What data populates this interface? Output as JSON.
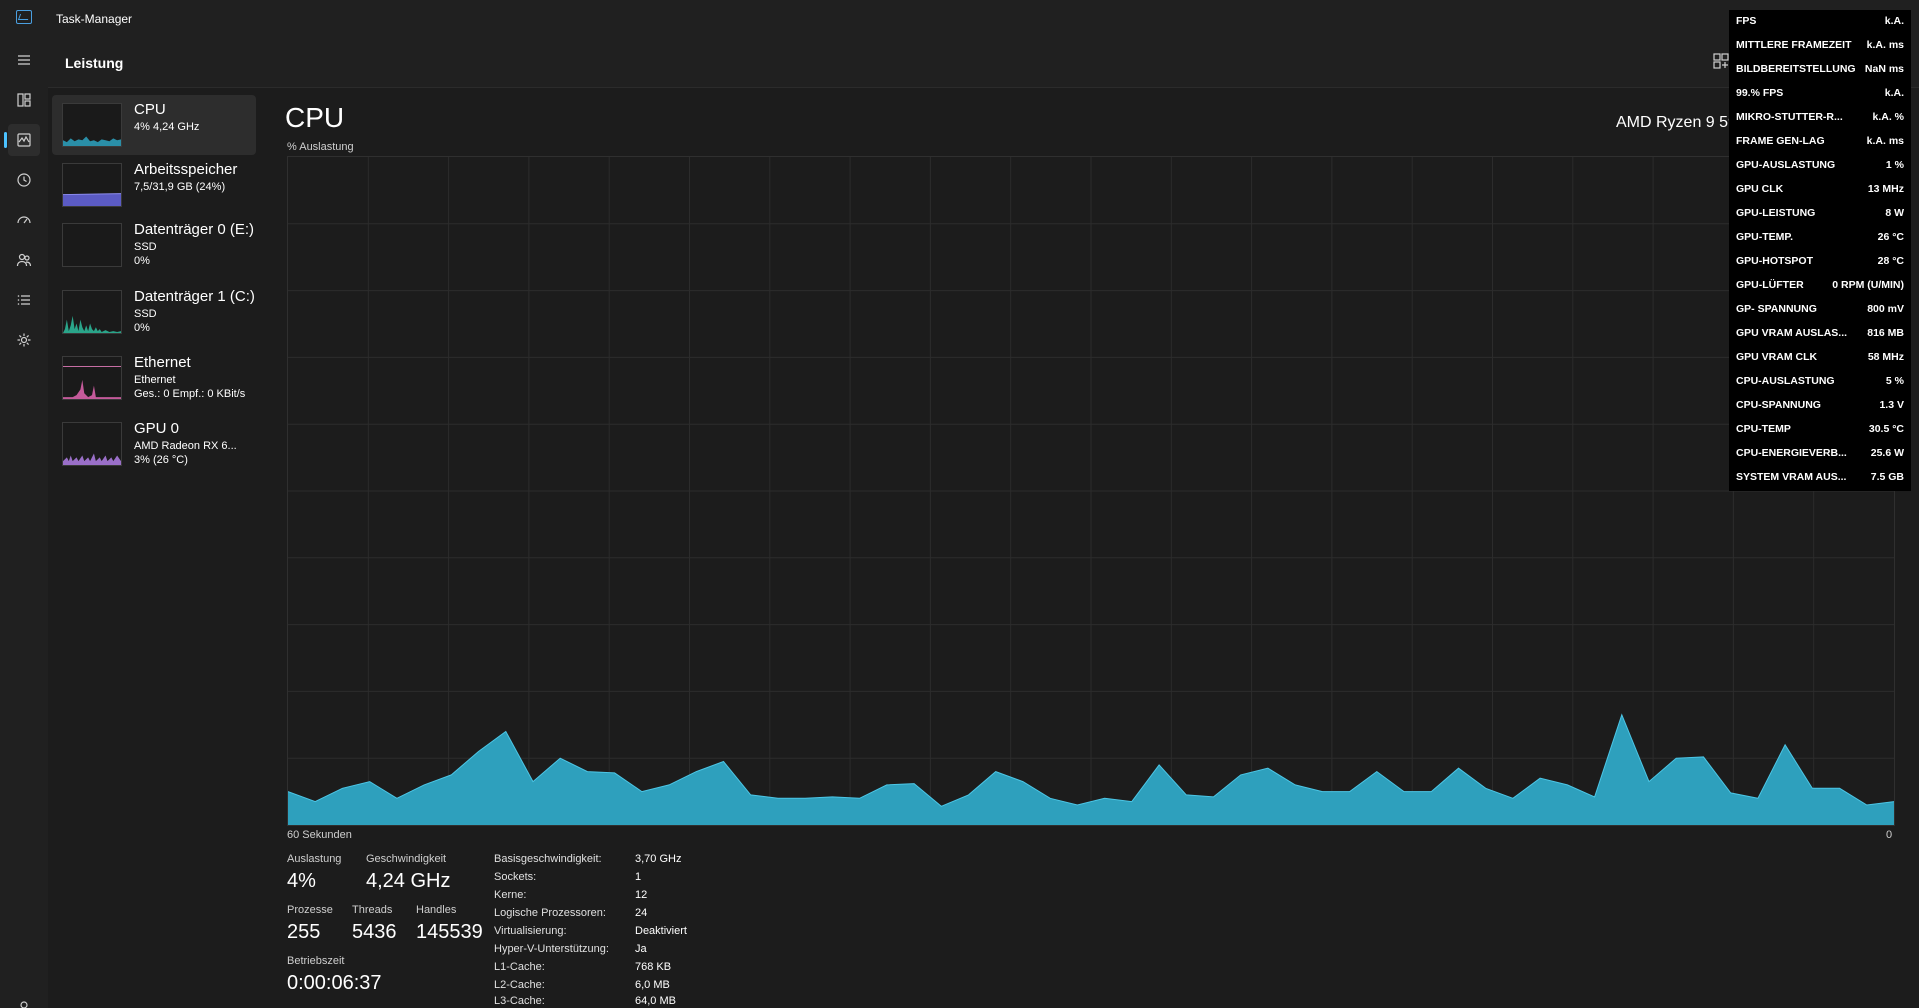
{
  "window": {
    "title": "Task-Manager"
  },
  "header": {
    "title": "Leistung"
  },
  "nav": {
    "items": [
      {
        "icon": "hamburger-icon"
      },
      {
        "icon": "processes-icon"
      },
      {
        "icon": "performance-icon"
      },
      {
        "icon": "history-icon"
      },
      {
        "icon": "startup-icon"
      },
      {
        "icon": "users-icon"
      },
      {
        "icon": "details-icon"
      },
      {
        "icon": "services-icon"
      },
      {
        "icon": "settings-icon"
      }
    ]
  },
  "sidebar": {
    "items": [
      {
        "name": "CPU",
        "sub1": "4% 4,24 GHz",
        "sub2": "",
        "sub3": "",
        "color": "#3ab8d8"
      },
      {
        "name": "Arbeitsspeicher",
        "sub1": "7,5/31,9 GB (24%)",
        "sub2": "",
        "sub3": "",
        "color": "#7a7ae0"
      },
      {
        "name": "Datenträger 0 (E:)",
        "sub1": "SSD",
        "sub2": "0%",
        "sub3": "",
        "color": "#3fb89c"
      },
      {
        "name": "Datenträger 1 (C:)",
        "sub1": "SSD",
        "sub2": "0%",
        "sub3": "",
        "color": "#3fb89c"
      },
      {
        "name": "Ethernet",
        "sub1": "Ethernet",
        "sub2": "Ges.: 0 Empf.: 0 KBit/s",
        "sub3": "",
        "color": "#e07ab8"
      },
      {
        "name": "GPU 0",
        "sub1": "AMD Radeon RX 6...",
        "sub2": "3% (26 °C)",
        "sub3": "",
        "color": "#b890e0"
      }
    ]
  },
  "main": {
    "title": "CPU",
    "subtitle": "% Auslastung",
    "model": "AMD Ryzen 9 59",
    "axis_left": "60 Sekunden",
    "axis_right": "0"
  },
  "chart_data": {
    "type": "area",
    "title": "CPU",
    "ylabel": "% Auslastung",
    "xlabel": "60 Sekunden",
    "ylim": [
      0,
      100
    ],
    "grid": true,
    "color": "#2ea0bd",
    "values": [
      5,
      3.5,
      5.5,
      6.5,
      4,
      6,
      7.5,
      11,
      14,
      6.5,
      10,
      8,
      7.8,
      5,
      6,
      8,
      9.5,
      4.5,
      4,
      4,
      4.2,
      4,
      6,
      6.2,
      2.8,
      4.5,
      8,
      6.5,
      4,
      3,
      4,
      3.5,
      9,
      4.5,
      4.2,
      7.5,
      8.5,
      6,
      5,
      5,
      8,
      5,
      5,
      8.5,
      5.5,
      4,
      7,
      6,
      4.2,
      16.5,
      6.5,
      10,
      10.2,
      4.8,
      4,
      12,
      5.5,
      5.5,
      3,
      3.5
    ]
  },
  "stats": {
    "auslastung_label": "Auslastung",
    "auslastung": "4%",
    "geschwindigkeit_label": "Geschwindigkeit",
    "geschwindigkeit": "4,24 GHz",
    "prozesse_label": "Prozesse",
    "prozesse": "255",
    "threads_label": "Threads",
    "threads": "5436",
    "handles_label": "Handles",
    "handles": "145539",
    "betriebszeit_label": "Betriebszeit",
    "betriebszeit": "0:00:06:37"
  },
  "info": [
    {
      "label": "Basisgeschwindigkeit:",
      "value": "3,70 GHz"
    },
    {
      "label": "Sockets:",
      "value": "1"
    },
    {
      "label": "Kerne:",
      "value": "12"
    },
    {
      "label": "Logische Prozessoren:",
      "value": "24"
    },
    {
      "label": "Virtualisierung:",
      "value": "Deaktiviert"
    },
    {
      "label": "Hyper-V-Unterstützung:",
      "value": "Ja"
    },
    {
      "label": "L1-Cache:",
      "value": "768 KB"
    },
    {
      "label": "L2-Cache:",
      "value": "6,0 MB"
    },
    {
      "label": "L3-Cache:",
      "value": "64,0 MB"
    }
  ],
  "overlay": [
    {
      "label": "FPS",
      "value": "k.A."
    },
    {
      "label": "MITTLERE FRAMEZEIT",
      "value": "k.A. ms"
    },
    {
      "label": "BILDBEREITSTELLUNG",
      "value": "NaN ms"
    },
    {
      "label": "99.% FPS",
      "value": "k.A."
    },
    {
      "label": "MIKRO-STUTTER-R...",
      "value": "k.A. %"
    },
    {
      "label": "FRAME GEN-LAG",
      "value": "k.A. ms"
    },
    {
      "label": "GPU-AUSLASTUNG",
      "value": "1 %"
    },
    {
      "label": "GPU CLK",
      "value": "13 MHz"
    },
    {
      "label": "GPU-LEISTUNG",
      "value": "8 W"
    },
    {
      "label": "GPU-TEMP.",
      "value": "26 °C"
    },
    {
      "label": "GPU-HOTSPOT",
      "value": "28 °C"
    },
    {
      "label": "GPU-LÜFTER",
      "value": "0 RPM (U/MIN)"
    },
    {
      "label": "GP- SPANNUNG",
      "value": "800 mV"
    },
    {
      "label": "GPU VRAM AUSLAS...",
      "value": "816 MB"
    },
    {
      "label": "GPU VRAM CLK",
      "value": "58 MHz"
    },
    {
      "label": "CPU-AUSLASTUNG",
      "value": "5 %"
    },
    {
      "label": "CPU-SPANNUNG",
      "value": "1.3 V"
    },
    {
      "label": "CPU-TEMP",
      "value": "30.5 °C"
    },
    {
      "label": "CPU-ENERGIEVERB...",
      "value": "25.6 W"
    },
    {
      "label": "SYSTEM VRAM AUS...",
      "value": "7.5 GB"
    }
  ]
}
